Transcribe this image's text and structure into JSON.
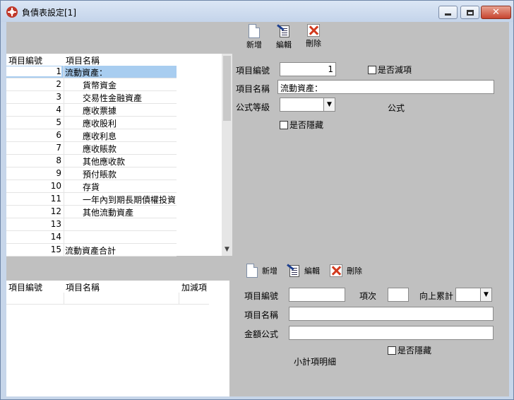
{
  "window": {
    "title": "負債表設定[1]",
    "minimize": "minimize",
    "maximize": "maximize",
    "close": "✕"
  },
  "toolbar_top": {
    "new": "新增",
    "edit": "編輯",
    "delete": "刪除"
  },
  "top_grid": {
    "headers": [
      "項目編號",
      "項目名稱"
    ],
    "rows": [
      {
        "no": "1",
        "name": "流動資產：",
        "indent": false
      },
      {
        "no": "2",
        "name": "貨幣資金",
        "indent": true
      },
      {
        "no": "3",
        "name": "交易性金融資產",
        "indent": true
      },
      {
        "no": "4",
        "name": "應收票據",
        "indent": true
      },
      {
        "no": "5",
        "name": "應收股利",
        "indent": true
      },
      {
        "no": "6",
        "name": "應收利息",
        "indent": true
      },
      {
        "no": "7",
        "name": "應收賬款",
        "indent": true
      },
      {
        "no": "8",
        "name": "其他應收款",
        "indent": true
      },
      {
        "no": "9",
        "name": "預付賬款",
        "indent": true
      },
      {
        "no": "10",
        "name": "存貨",
        "indent": true
      },
      {
        "no": "11",
        "name": "一年內到期長期債權投資",
        "indent": true
      },
      {
        "no": "12",
        "name": "其他流動資產",
        "indent": true
      },
      {
        "no": "13",
        "name": "",
        "indent": false
      },
      {
        "no": "14",
        "name": "",
        "indent": false
      },
      {
        "no": "15",
        "name": "流動資產合計",
        "indent": false
      }
    ]
  },
  "top_form": {
    "item_no_label": "項目編號",
    "item_no_value": "1",
    "deduct_label": "是否減項",
    "item_name_label": "項目名稱",
    "item_name_value": "流動資產：",
    "formula_level_label": "公式等級",
    "formula_level_value": "",
    "formula_label": "公式",
    "hidden_label": "是否隱藏"
  },
  "toolbar_bottom": {
    "new": "新增",
    "edit": "編輯",
    "delete": "刪除"
  },
  "bottom_grid": {
    "headers": [
      "項目編號",
      "項目名稱",
      "加減項"
    ]
  },
  "bottom_form": {
    "item_no_label": "項目編號",
    "item_no_value": "",
    "order_label": "項次",
    "order_value": "",
    "accumulate_value": "向上累計",
    "item_name_label": "項目名稱",
    "item_name_value": "",
    "amount_formula_label": "金額公式",
    "amount_formula_value": "",
    "hidden_label": "是否隱藏",
    "subtotal_label": "小計項明細"
  }
}
